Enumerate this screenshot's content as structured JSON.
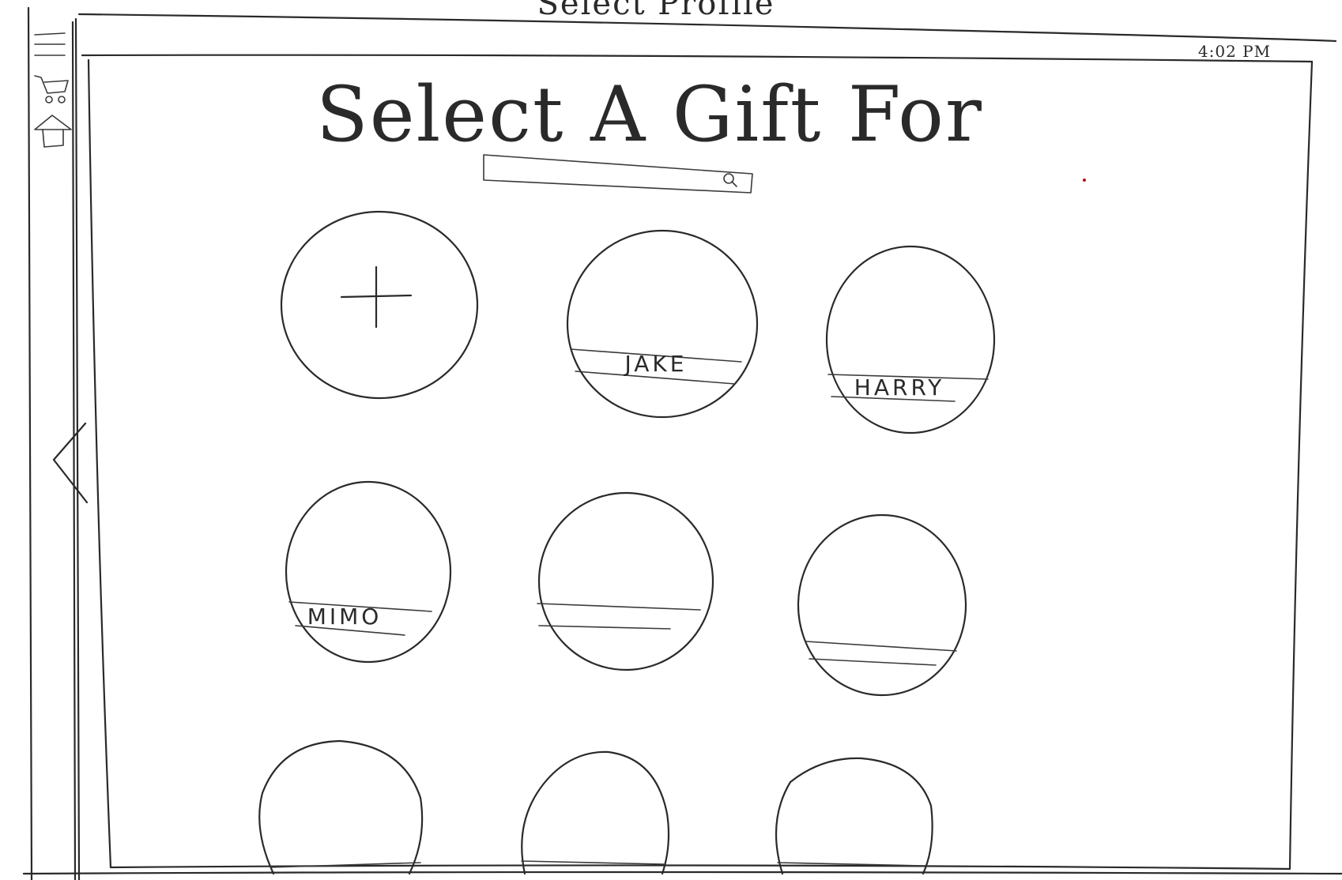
{
  "app": {
    "top_title": "Select Profile",
    "time": "4:02 PM"
  },
  "main": {
    "heading": "Select A Gift For",
    "search": {
      "value": "",
      "icon": "search-icon"
    }
  },
  "sidebar": {
    "icons": [
      "menu-icon",
      "cart-icon",
      "home-icon"
    ]
  },
  "nav": {
    "back_icon": "chevron-left-icon"
  },
  "profiles": {
    "add_icon": "plus-icon",
    "names": [
      "JAKE",
      "HARRY",
      "MIMO",
      "",
      "",
      "",
      "",
      ""
    ]
  },
  "colors": {
    "ink": "#2a2a2a",
    "paper": "#ffffff"
  }
}
